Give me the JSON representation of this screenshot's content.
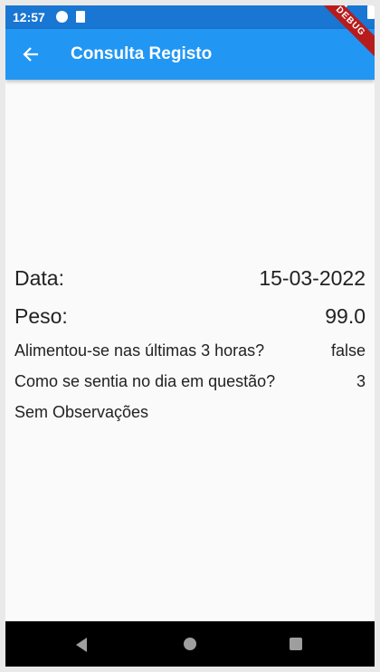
{
  "status_bar": {
    "time": "12:57"
  },
  "app_bar": {
    "title": "Consulta Registo",
    "debug_label": "DEBUG"
  },
  "record": {
    "data_label": "Data:",
    "data_value": "15-03-2022",
    "peso_label": "Peso:",
    "peso_value": "99.0",
    "ate_label": "Alimentou-se nas últimas 3 horas?",
    "ate_value": "false",
    "feel_label": "Como se sentia no dia em questão?",
    "feel_value": "3",
    "observations": "Sem Observações"
  },
  "colors": {
    "app_bar": "#2196f3",
    "status_bar": "#1976d2",
    "background": "#fafafa"
  }
}
